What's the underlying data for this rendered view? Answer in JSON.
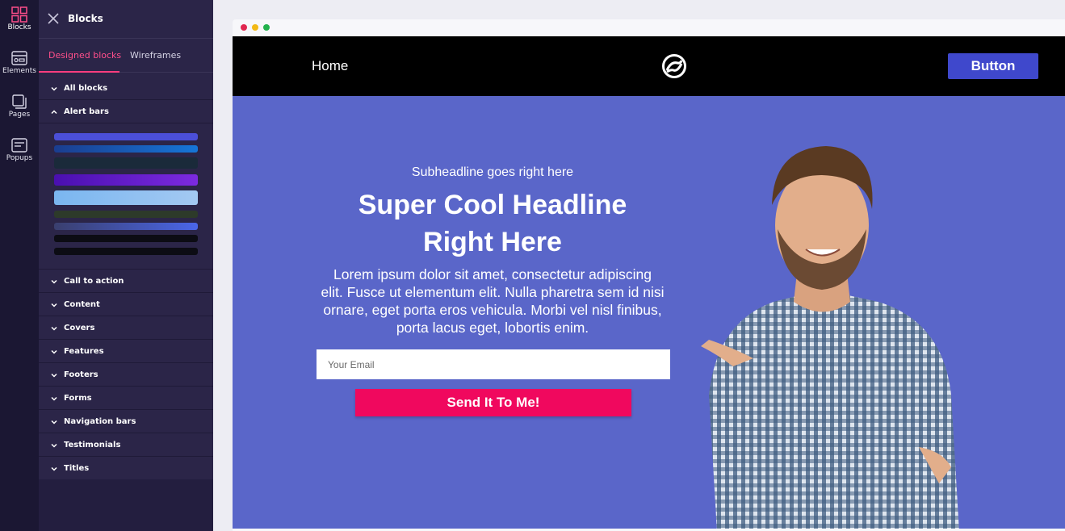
{
  "rail": {
    "items": [
      {
        "label": "Blocks",
        "icon": "blocks-grid-icon",
        "active": true
      },
      {
        "label": "Elements",
        "icon": "elements-icon"
      },
      {
        "label": "Pages",
        "icon": "pages-icon"
      },
      {
        "label": "Popups",
        "icon": "popups-icon"
      }
    ]
  },
  "panel": {
    "title": "Blocks",
    "tabs": [
      "Designed blocks",
      "Wireframes"
    ],
    "categories": [
      {
        "label": "All blocks",
        "expanded": false
      },
      {
        "label": "Alert bars",
        "expanded": true
      },
      {
        "label": "Call to action",
        "expanded": false
      },
      {
        "label": "Content",
        "expanded": false
      },
      {
        "label": "Covers",
        "expanded": false
      },
      {
        "label": "Features",
        "expanded": false
      },
      {
        "label": "Footers",
        "expanded": false
      },
      {
        "label": "Forms",
        "expanded": false
      },
      {
        "label": "Navigation bars",
        "expanded": false
      },
      {
        "label": "Testimonials",
        "expanded": false
      },
      {
        "label": "Titles",
        "expanded": false
      }
    ]
  },
  "site": {
    "nav": {
      "home": "Home",
      "button": "Button",
      "logo_icon": "swirl-logo-icon"
    },
    "hero": {
      "subheadline": "Subheadline goes right here",
      "headline_line1": "Super Cool Headline",
      "headline_line2": "Right Here",
      "body_lines": [
        "Lorem ipsum dolor sit amet, consectetur adipiscing",
        "elit. Fusce ut elementum elit. Nulla pharetra sem id nisi",
        "ornare, eget porta eros vehicula. Morbi vel nisl finibus,",
        "porta lacus eget, lobortis enim."
      ],
      "email_placeholder": "Your Email",
      "cta": "Send It To Me!"
    }
  },
  "colors": {
    "rail_bg": "#1b1733",
    "panel_bg": "#2b2548",
    "accent_pink": "#ff3d7f",
    "hero_bg": "#5a66c9",
    "nav_button": "#3f48cc",
    "cta": "#f0085e"
  }
}
